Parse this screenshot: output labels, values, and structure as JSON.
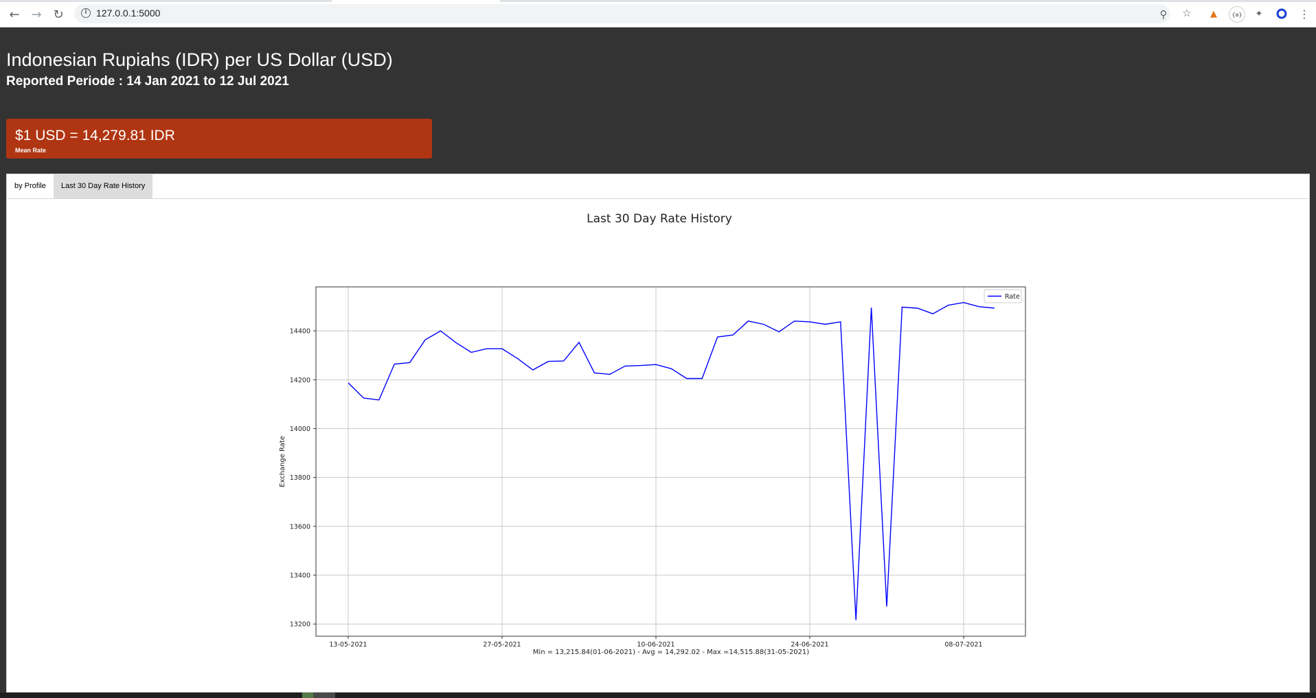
{
  "browser": {
    "url": "127.0.0.1:5000",
    "icons": [
      "back-icon",
      "forward-icon",
      "reload-icon",
      "info-icon",
      "zoom-icon",
      "bookmark-star-icon",
      "metamask-fox-icon",
      "json-extension-icon",
      "extensions-puzzle-icon",
      "profile-icon",
      "menu-dots-icon"
    ],
    "json_ext_label": "{a}"
  },
  "header": {
    "title": "Indonesian Rupiahs (IDR) per US Dollar (USD)",
    "subtitle": "Reported Periode : 14 Jan 2021 to 12 Jul 2021"
  },
  "rate_card": {
    "value": "$1 USD = 14,279.81 IDR",
    "caption": "Mean Rate",
    "color": "#b03512"
  },
  "tabs": [
    {
      "label": "by Profile",
      "active": false
    },
    {
      "label": "Last 30 Day Rate History",
      "active": true
    }
  ],
  "chart_data": {
    "type": "line",
    "title": "Last 30 Day Rate History",
    "xlabel": "Min = 13,215.84(01-06-2021) - Avg = 14,292.02 - Max =14,515.88(31-05-2021)",
    "ylabel": "Exchange Rate",
    "legend": "top-right",
    "grid": true,
    "x_ticks": [
      "13-05-2021",
      "27-05-2021",
      "10-06-2021",
      "24-06-2021",
      "08-07-2021"
    ],
    "y_ticks": [
      13200,
      13400,
      13600,
      13800,
      14000,
      14200,
      14400
    ],
    "ylim": [
      13150,
      14580
    ],
    "series": [
      {
        "name": "Rate",
        "color": "#0000ff",
        "values": [
          14187,
          14125,
          14117,
          14264,
          14270,
          14363,
          14400,
          14352,
          14312,
          14327,
          14327,
          14287,
          14240,
          14275,
          14277,
          14353,
          14228,
          14222,
          14256,
          14258,
          14262,
          14245,
          14205,
          14205,
          14375,
          14383,
          14440,
          14427,
          14396,
          14440,
          14437,
          14427,
          14437,
          13216,
          14495,
          13272,
          14497,
          14493,
          14470,
          14505,
          14516,
          14499,
          14493
        ]
      }
    ]
  }
}
